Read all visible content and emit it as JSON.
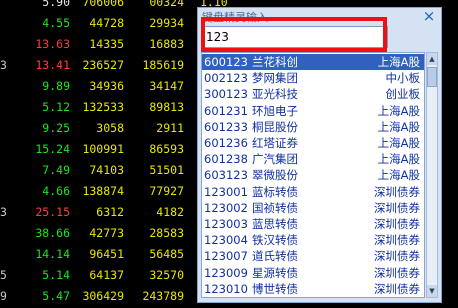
{
  "stock_rows": [
    {
      "idx": "",
      "price": "5.90",
      "vol": "706006",
      "amt": "00324",
      "x": "1.10",
      "price_color": "white"
    },
    {
      "idx": "",
      "price": "4.55",
      "vol": "44728",
      "amt": "29934",
      "x": "",
      "price_color": "green"
    },
    {
      "idx": "",
      "price": "13.63",
      "vol": "14335",
      "amt": "16883",
      "x": "",
      "price_color": "red"
    },
    {
      "idx": "3",
      "price": "13.41",
      "vol": "236527",
      "amt": "185619",
      "x": "",
      "price_color": "red"
    },
    {
      "idx": "",
      "price": "9.89",
      "vol": "34936",
      "amt": "34147",
      "x": "",
      "price_color": "green"
    },
    {
      "idx": "",
      "price": "5.12",
      "vol": "132533",
      "amt": "89813",
      "x": "",
      "price_color": "green"
    },
    {
      "idx": "",
      "price": "9.25",
      "vol": "3058",
      "amt": "2911",
      "x": "",
      "price_color": "green"
    },
    {
      "idx": "",
      "price": "15.24",
      "vol": "100991",
      "amt": "86593",
      "x": "",
      "price_color": "green"
    },
    {
      "idx": "",
      "price": "7.49",
      "vol": "74103",
      "amt": "51501",
      "x": "",
      "price_color": "green"
    },
    {
      "idx": "",
      "price": "4.66",
      "vol": "138874",
      "amt": "77927",
      "x": "",
      "price_color": "green"
    },
    {
      "idx": "3",
      "price": "25.15",
      "vol": "6312",
      "amt": "4182",
      "x": "",
      "price_color": "red"
    },
    {
      "idx": "",
      "price": "38.66",
      "vol": "42773",
      "amt": "28583",
      "x": "",
      "price_color": "green"
    },
    {
      "idx": "",
      "price": "14.14",
      "vol": "96451",
      "amt": "56485",
      "x": "",
      "price_color": "green"
    },
    {
      "idx": "5",
      "price": "5.14",
      "vol": "64137",
      "amt": "32570",
      "x": "",
      "price_color": "green"
    },
    {
      "idx": "9",
      "price": "5.47",
      "vol": "306429",
      "amt": "243789",
      "x": "",
      "price_color": "green"
    }
  ],
  "popup": {
    "title": "键盘精灵输入",
    "close_glyph": "×",
    "search_value": "123"
  },
  "results": [
    {
      "code": "600123",
      "name": "兰花科创",
      "board": "上海A股",
      "selected": true
    },
    {
      "code": "002123",
      "name": "梦网集团",
      "board": "中小板",
      "selected": false
    },
    {
      "code": "300123",
      "name": "亚光科技",
      "board": "创业板",
      "selected": false
    },
    {
      "code": "601231",
      "name": "环旭电子",
      "board": "上海A股",
      "selected": false
    },
    {
      "code": "601233",
      "name": "桐昆股份",
      "board": "上海A股",
      "selected": false
    },
    {
      "code": "601236",
      "name": "红塔证券",
      "board": "上海A股",
      "selected": false
    },
    {
      "code": "601238",
      "name": "广汽集团",
      "board": "上海A股",
      "selected": false
    },
    {
      "code": "603123",
      "name": "翠微股份",
      "board": "上海A股",
      "selected": false
    },
    {
      "code": "123001",
      "name": "蓝标转债",
      "board": "深圳债券",
      "selected": false
    },
    {
      "code": "123002",
      "name": "国祯转债",
      "board": "深圳债券",
      "selected": false
    },
    {
      "code": "123003",
      "name": "蓝思转债",
      "board": "深圳债券",
      "selected": false
    },
    {
      "code": "123004",
      "name": "铁汉转债",
      "board": "深圳债券",
      "selected": false
    },
    {
      "code": "123007",
      "name": "道氏转债",
      "board": "深圳债券",
      "selected": false
    },
    {
      "code": "123009",
      "name": "星源转债",
      "board": "深圳债券",
      "selected": false
    },
    {
      "code": "123010",
      "name": "博世转债",
      "board": "深圳债券",
      "selected": false
    }
  ],
  "icons": {
    "close": "close-icon",
    "scroll_up": "scroll-up-arrow-icon",
    "scroll_down": "scroll-down-arrow-icon"
  },
  "colors": {
    "up": "#ff3c3c",
    "down": "#19e619",
    "volume": "#e8e800",
    "highlight": "#ee1111",
    "selection": "#3060c0"
  }
}
